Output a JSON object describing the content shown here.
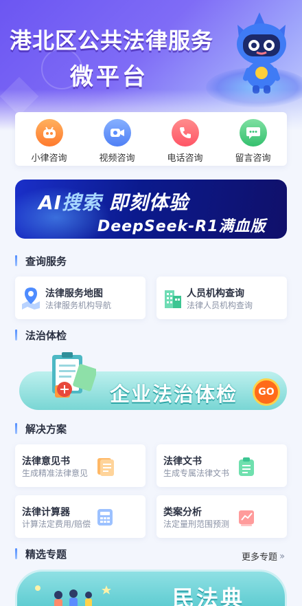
{
  "hero": {
    "title": "港北区公共法律服务",
    "subtitle": "微平台"
  },
  "consult": [
    {
      "label": "小律咨询",
      "icon": "robot-icon",
      "color": "#ff8a3d"
    },
    {
      "label": "视频咨询",
      "icon": "video-camera-icon",
      "color": "#5a8dff"
    },
    {
      "label": "电话咨询",
      "icon": "phone-icon",
      "color": "#ff5f6d"
    },
    {
      "label": "留言咨询",
      "icon": "message-icon",
      "color": "#3cc57a"
    }
  ],
  "ai_banner": {
    "ai": "AI",
    "search": "搜索",
    "experience": "即刻体验",
    "model": "DeepSeek-R1满血版"
  },
  "sections": {
    "query": "查询服务",
    "checkup": "法治体检",
    "solutions": "解决方案",
    "featured": "精选专题",
    "more": "更多专题"
  },
  "query_services": [
    {
      "title": "法律服务地图",
      "sub": "法律服务机构导航",
      "icon": "map-pin-icon"
    },
    {
      "title": "人员机构查询",
      "sub": "法律人员机构查询",
      "icon": "building-icon"
    }
  ],
  "checkup_banner": {
    "text": "企业法治体检",
    "go": "GO"
  },
  "solutions": [
    {
      "title": "法律意见书",
      "sub": "生成精准法律意见",
      "icon": "document-icon"
    },
    {
      "title": "法律文书",
      "sub": "生成专属法律文书",
      "icon": "clipboard-icon"
    },
    {
      "title": "法律计算器",
      "sub": "计算法定费用/赔偿",
      "icon": "calculator-icon"
    },
    {
      "title": "类案分析",
      "sub": "法定量刑范围预测",
      "icon": "chart-icon"
    }
  ],
  "topic_banner": {
    "text": "民法典"
  },
  "colors": {
    "accent": "#4e8cff",
    "hero": "#6c56f2"
  }
}
